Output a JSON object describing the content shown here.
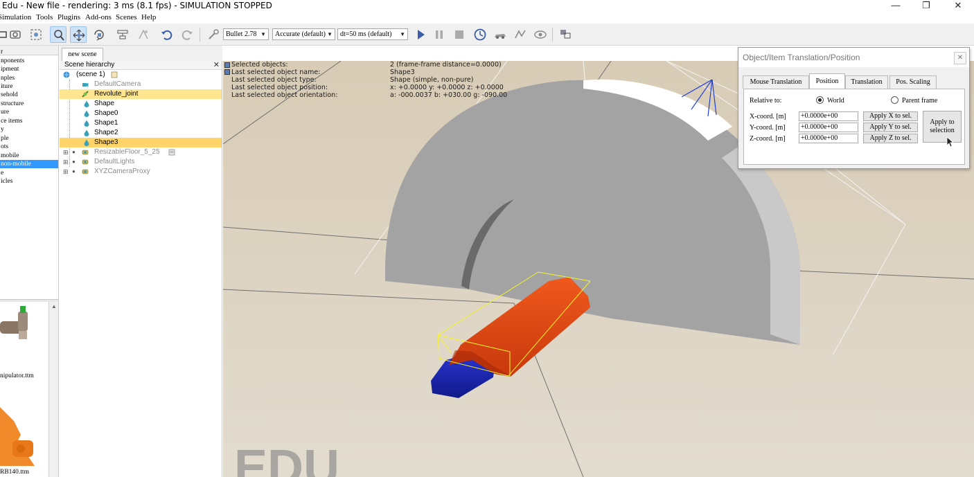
{
  "window": {
    "title": "Edu - New file - rendering: 3 ms (8.1 fps) - SIMULATION STOPPED",
    "minimize": "—",
    "maximize": "❐",
    "close": "✕"
  },
  "menu": [
    "Simulation",
    "Tools",
    "Plugins",
    "Add-ons",
    "Scenes",
    "Help"
  ],
  "toolbar": {
    "engine": "Bullet 2.78",
    "accuracy": "Accurate (default)",
    "timestep": "dt=50 ms (default)",
    "icons": [
      "camera-pan-icon",
      "camera-rotate-icon",
      "camera-fit-icon",
      "object-select-icon",
      "object-move-icon",
      "object-rotate-icon",
      "assemble-icon",
      "transfer-dna-icon",
      "undo-icon",
      "redo-icon",
      "pick-icon",
      "play-icon",
      "pause-icon",
      "stop-icon",
      "realtime-icon",
      "slow-icon",
      "fast-icon",
      "visualization-icon",
      "toggle-page-icon"
    ]
  },
  "model_browser": {
    "items": [
      "r",
      "nponents",
      "ipment",
      "nples",
      "iture",
      "sehold",
      "structure",
      "ure",
      "ce items",
      "y",
      "ple",
      "ots",
      "mobile",
      "non-mobile",
      "e",
      "icles"
    ],
    "selected_index": 13,
    "thumbnails": [
      {
        "label": "nipulator.ttm"
      },
      {
        "label": "RB140.ttm"
      }
    ]
  },
  "scene_tab": "new scene",
  "hierarchy": {
    "header": "Scene hierarchy",
    "close": "✕",
    "rows": [
      {
        "label": "(scene 1)",
        "kind": "scene",
        "dim": false
      },
      {
        "label": "DefaultCamera",
        "kind": "camera",
        "dim": true
      },
      {
        "label": "Revolute_joint",
        "kind": "joint",
        "dim": false
      },
      {
        "label": "Shape",
        "kind": "shape",
        "dim": false
      },
      {
        "label": "Shape0",
        "kind": "shape",
        "dim": false
      },
      {
        "label": "Shape1",
        "kind": "shape",
        "dim": false
      },
      {
        "label": "Shape2",
        "kind": "shape",
        "dim": false
      },
      {
        "label": "Shape3",
        "kind": "shape",
        "dim": false
      },
      {
        "label": "ResizableFloor_5_25",
        "kind": "model",
        "dim": true
      },
      {
        "label": "DefaultLights",
        "kind": "model",
        "dim": true
      },
      {
        "label": "XYZCameraProxy",
        "kind": "model",
        "dim": true
      }
    ]
  },
  "info_overlay": {
    "rows": [
      {
        "label": "Selected objects:",
        "value": "2 (frame-frame distance=0.0000)"
      },
      {
        "label": "Last selected object name:",
        "value": "Shape3"
      },
      {
        "label": "Last selected object type:",
        "value": "Shape (simple, non-pure)"
      },
      {
        "label": "Last selected object position:",
        "value": "x: +0.0000    y: +0.0000    z: +0.0000"
      },
      {
        "label": "Last selected object orientation:",
        "value": "a: -000.0037    b: +030.00    g: -090.00"
      }
    ]
  },
  "watermark": "EDU",
  "viewport_colors": {
    "floor": "#d9cdb8",
    "hemisphere": "#a3a3a3",
    "orange_part": "#e2400f",
    "blue_part": "#1a22b0",
    "bbox": "#ffff33"
  },
  "dialog": {
    "title": "Object/Item Translation/Position",
    "close": "✕",
    "tabs": [
      "Mouse Translation",
      "Position",
      "Translation",
      "Pos. Scaling"
    ],
    "active_tab": 1,
    "relative_to_label": "Relative to:",
    "relative_options": [
      "World",
      "Parent frame"
    ],
    "relative_selected": "World",
    "coords": [
      {
        "label": "X-coord. [m]",
        "value": "+0.0000e+00",
        "button": "Apply X to sel."
      },
      {
        "label": "Y-coord. [m]",
        "value": "+0.0000e+00",
        "button": "Apply Y to sel."
      },
      {
        "label": "Z-coord. [m]",
        "value": "+0.0000e+00",
        "button": "Apply Z to sel."
      }
    ],
    "apply_all_line1": "Apply to",
    "apply_all_line2": "selection"
  }
}
